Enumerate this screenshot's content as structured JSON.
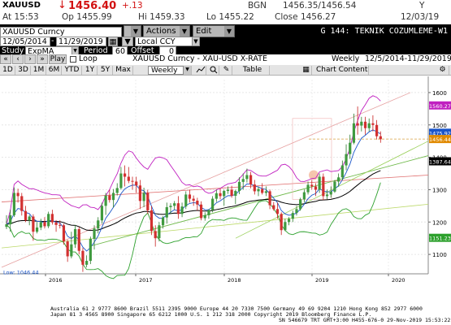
{
  "quote": {
    "symbol": "XAUUSD",
    "arrow": "↓",
    "last": "1456.40",
    "change": "+.13",
    "source": "BGN",
    "bid_ask": "1456.35/1456.54",
    "bid_ask_size": "Y",
    "time": "At 15:53",
    "open": "Op 1455.99",
    "high": "Hi 1459.33",
    "low": "Lo 1455.22",
    "close": "Close 1456.27",
    "date": "12/03/19"
  },
  "toolbar": {
    "dropdown1_label": "",
    "actions_label": "Actions",
    "edit_label": "Edit",
    "page_title": "G 144: TEKNIK COZUMLEME-W1",
    "ticker_field": "XAUUSD Curncy",
    "date_from": "12/05/2014",
    "date_sep": "-",
    "date_to": "11/29/2019",
    "currency": "Local CCY",
    "study_label": "Study",
    "study_value": "ExpMA",
    "period_label": "Period",
    "period_value": "60",
    "offset_label": "Offset",
    "offset_value": "0"
  },
  "row3": {
    "play": "Play",
    "loop": "Loop",
    "description": "XAUUSD Curncy - XAU-USD X-RATE",
    "frequency": "Weekly",
    "range": "12/5/2014-11/29/2019"
  },
  "tabs": {
    "items": [
      "1D",
      "3D",
      "1M",
      "6M",
      "YTD",
      "1Y",
      "5Y",
      "Max"
    ],
    "frequency": "Weekly",
    "table": "Table",
    "chart_content": "Chart Content"
  },
  "chart_data": {
    "type": "candlestick",
    "title": "",
    "x_labels": [
      "2016",
      "2017",
      "2018",
      "2019",
      "2020"
    ],
    "y_ticks": [
      1100,
      1200,
      1300,
      1400,
      1500,
      1600
    ],
    "ylim": [
      1040,
      1640
    ],
    "low_label": "Low: 1046.44",
    "price_labels": [
      {
        "value": "1560.27",
        "color": "#c020c0",
        "at": 1560.27
      },
      {
        "value": "1475.92",
        "color": "#1a55c9",
        "at": 1475.92
      },
      {
        "value": "1456.44",
        "color": "#e08a00",
        "at": 1456.44
      },
      {
        "value": "1387.64",
        "color": "#000000",
        "at": 1387.64
      },
      {
        "value": "1151.23",
        "color": "#2ca02c",
        "at": 1151.23
      }
    ],
    "candles": [
      {
        "o": 1185,
        "h": 1221,
        "l": 1178,
        "c": 1193
      },
      {
        "o": 1193,
        "h": 1238,
        "l": 1170,
        "c": 1221
      },
      {
        "o": 1221,
        "h": 1307,
        "l": 1216,
        "c": 1290
      },
      {
        "o": 1290,
        "h": 1303,
        "l": 1260,
        "c": 1280
      },
      {
        "o": 1280,
        "h": 1290,
        "l": 1220,
        "c": 1234
      },
      {
        "o": 1234,
        "h": 1250,
        "l": 1200,
        "c": 1205
      },
      {
        "o": 1205,
        "h": 1222,
        "l": 1190,
        "c": 1217
      },
      {
        "o": 1217,
        "h": 1224,
        "l": 1142,
        "c": 1170
      },
      {
        "o": 1170,
        "h": 1200,
        "l": 1165,
        "c": 1183
      },
      {
        "o": 1183,
        "h": 1210,
        "l": 1175,
        "c": 1200
      },
      {
        "o": 1200,
        "h": 1215,
        "l": 1180,
        "c": 1187
      },
      {
        "o": 1187,
        "h": 1232,
        "l": 1181,
        "c": 1225
      },
      {
        "o": 1225,
        "h": 1238,
        "l": 1192,
        "c": 1199
      },
      {
        "o": 1199,
        "h": 1206,
        "l": 1170,
        "c": 1191
      },
      {
        "o": 1191,
        "h": 1205,
        "l": 1180,
        "c": 1190
      },
      {
        "o": 1190,
        "h": 1195,
        "l": 1130,
        "c": 1140
      },
      {
        "o": 1140,
        "h": 1145,
        "l": 1077,
        "c": 1094
      },
      {
        "o": 1094,
        "h": 1170,
        "l": 1088,
        "c": 1131
      },
      {
        "o": 1131,
        "h": 1191,
        "l": 1120,
        "c": 1178
      },
      {
        "o": 1178,
        "h": 1185,
        "l": 1100,
        "c": 1111
      },
      {
        "o": 1111,
        "h": 1120,
        "l": 1046,
        "c": 1068
      },
      {
        "o": 1068,
        "h": 1097,
        "l": 1060,
        "c": 1080
      },
      {
        "o": 1080,
        "h": 1155,
        "l": 1070,
        "c": 1148
      },
      {
        "o": 1148,
        "h": 1190,
        "l": 1115,
        "c": 1180
      },
      {
        "o": 1180,
        "h": 1215,
        "l": 1165,
        "c": 1205
      },
      {
        "o": 1205,
        "h": 1260,
        "l": 1195,
        "c": 1250
      },
      {
        "o": 1250,
        "h": 1290,
        "l": 1222,
        "c": 1282
      },
      {
        "o": 1282,
        "h": 1300,
        "l": 1260,
        "c": 1268
      },
      {
        "o": 1268,
        "h": 1302,
        "l": 1245,
        "c": 1290
      },
      {
        "o": 1290,
        "h": 1320,
        "l": 1282,
        "c": 1305
      },
      {
        "o": 1305,
        "h": 1370,
        "l": 1300,
        "c": 1350
      },
      {
        "o": 1350,
        "h": 1375,
        "l": 1310,
        "c": 1340
      },
      {
        "o": 1340,
        "h": 1370,
        "l": 1320,
        "c": 1327
      },
      {
        "o": 1327,
        "h": 1340,
        "l": 1300,
        "c": 1325
      },
      {
        "o": 1325,
        "h": 1340,
        "l": 1290,
        "c": 1313
      },
      {
        "o": 1313,
        "h": 1330,
        "l": 1240,
        "c": 1265
      },
      {
        "o": 1265,
        "h": 1306,
        "l": 1246,
        "c": 1290
      },
      {
        "o": 1290,
        "h": 1300,
        "l": 1225,
        "c": 1236
      },
      {
        "o": 1236,
        "h": 1250,
        "l": 1160,
        "c": 1172
      },
      {
        "o": 1172,
        "h": 1190,
        "l": 1124,
        "c": 1150
      },
      {
        "o": 1150,
        "h": 1200,
        "l": 1140,
        "c": 1190
      },
      {
        "o": 1190,
        "h": 1218,
        "l": 1180,
        "c": 1214
      },
      {
        "o": 1214,
        "h": 1260,
        "l": 1195,
        "c": 1246
      },
      {
        "o": 1246,
        "h": 1258,
        "l": 1225,
        "c": 1250
      },
      {
        "o": 1250,
        "h": 1265,
        "l": 1238,
        "c": 1258
      },
      {
        "o": 1258,
        "h": 1280,
        "l": 1210,
        "c": 1225
      },
      {
        "o": 1225,
        "h": 1260,
        "l": 1215,
        "c": 1248
      },
      {
        "o": 1248,
        "h": 1295,
        "l": 1240,
        "c": 1285
      },
      {
        "o": 1285,
        "h": 1300,
        "l": 1260,
        "c": 1272
      },
      {
        "o": 1272,
        "h": 1282,
        "l": 1250,
        "c": 1266
      },
      {
        "o": 1266,
        "h": 1275,
        "l": 1235,
        "c": 1254
      },
      {
        "o": 1254,
        "h": 1264,
        "l": 1205,
        "c": 1212
      },
      {
        "o": 1212,
        "h": 1230,
        "l": 1204,
        "c": 1221
      },
      {
        "o": 1221,
        "h": 1240,
        "l": 1210,
        "c": 1237
      },
      {
        "o": 1237,
        "h": 1280,
        "l": 1230,
        "c": 1272
      },
      {
        "o": 1272,
        "h": 1300,
        "l": 1262,
        "c": 1289
      },
      {
        "o": 1289,
        "h": 1305,
        "l": 1270,
        "c": 1280
      },
      {
        "o": 1280,
        "h": 1300,
        "l": 1250,
        "c": 1296
      },
      {
        "o": 1296,
        "h": 1310,
        "l": 1287,
        "c": 1300
      },
      {
        "o": 1300,
        "h": 1312,
        "l": 1275,
        "c": 1281
      },
      {
        "o": 1281,
        "h": 1300,
        "l": 1255,
        "c": 1296
      },
      {
        "o": 1296,
        "h": 1338,
        "l": 1286,
        "c": 1324
      },
      {
        "o": 1324,
        "h": 1350,
        "l": 1300,
        "c": 1333
      },
      {
        "o": 1333,
        "h": 1365,
        "l": 1322,
        "c": 1345
      },
      {
        "o": 1345,
        "h": 1355,
        "l": 1304,
        "c": 1316
      },
      {
        "o": 1316,
        "h": 1330,
        "l": 1285,
        "c": 1295
      },
      {
        "o": 1295,
        "h": 1310,
        "l": 1280,
        "c": 1302
      },
      {
        "o": 1302,
        "h": 1320,
        "l": 1285,
        "c": 1290
      },
      {
        "o": 1290,
        "h": 1310,
        "l": 1280,
        "c": 1295
      },
      {
        "o": 1295,
        "h": 1300,
        "l": 1240,
        "c": 1252
      },
      {
        "o": 1252,
        "h": 1262,
        "l": 1235,
        "c": 1240
      },
      {
        "o": 1240,
        "h": 1260,
        "l": 1210,
        "c": 1225
      },
      {
        "o": 1225,
        "h": 1230,
        "l": 1160,
        "c": 1175
      },
      {
        "o": 1175,
        "h": 1210,
        "l": 1172,
        "c": 1200
      },
      {
        "o": 1200,
        "h": 1215,
        "l": 1190,
        "c": 1210
      },
      {
        "o": 1210,
        "h": 1235,
        "l": 1200,
        "c": 1228
      },
      {
        "o": 1228,
        "h": 1250,
        "l": 1220,
        "c": 1240
      },
      {
        "o": 1240,
        "h": 1275,
        "l": 1235,
        "c": 1270
      },
      {
        "o": 1270,
        "h": 1300,
        "l": 1260,
        "c": 1292
      },
      {
        "o": 1292,
        "h": 1325,
        "l": 1285,
        "c": 1315
      },
      {
        "o": 1315,
        "h": 1330,
        "l": 1300,
        "c": 1310
      },
      {
        "o": 1310,
        "h": 1320,
        "l": 1280,
        "c": 1300
      },
      {
        "o": 1300,
        "h": 1350,
        "l": 1290,
        "c": 1340
      },
      {
        "o": 1340,
        "h": 1350,
        "l": 1268,
        "c": 1280
      },
      {
        "o": 1280,
        "h": 1300,
        "l": 1270,
        "c": 1285
      },
      {
        "o": 1285,
        "h": 1310,
        "l": 1275,
        "c": 1294
      },
      {
        "o": 1294,
        "h": 1330,
        "l": 1290,
        "c": 1325
      },
      {
        "o": 1325,
        "h": 1350,
        "l": 1310,
        "c": 1338
      },
      {
        "o": 1338,
        "h": 1390,
        "l": 1330,
        "c": 1375
      },
      {
        "o": 1375,
        "h": 1440,
        "l": 1360,
        "c": 1410
      },
      {
        "o": 1410,
        "h": 1470,
        "l": 1395,
        "c": 1445
      },
      {
        "o": 1445,
        "h": 1535,
        "l": 1440,
        "c": 1505
      },
      {
        "o": 1505,
        "h": 1557,
        "l": 1470,
        "c": 1498
      },
      {
        "o": 1498,
        "h": 1525,
        "l": 1480,
        "c": 1510
      },
      {
        "o": 1510,
        "h": 1525,
        "l": 1470,
        "c": 1490
      },
      {
        "o": 1490,
        "h": 1520,
        "l": 1480,
        "c": 1505
      },
      {
        "o": 1505,
        "h": 1530,
        "l": 1480,
        "c": 1500
      },
      {
        "o": 1500,
        "h": 1515,
        "l": 1455,
        "c": 1465
      },
      {
        "o": 1465,
        "h": 1480,
        "l": 1445,
        "c": 1456
      }
    ]
  },
  "footer": {
    "line1": "Australia 61 2 9777 8600 Brazil 5511 2395 9000 Europe 44 20 7330 7500 Germany 49 69 9204 1210 Hong Kong 852 2977 6000",
    "line2": "Japan 81 3 4565 8900         Singapore 65 6212 1000       U.S. 1 212 318 2000            Copyright 2019 Bloomberg Finance L.P.",
    "line3": "SN 546679 TRT  GMT+3:00 H455-676-0 29-Nov-2019 15:53:22"
  }
}
